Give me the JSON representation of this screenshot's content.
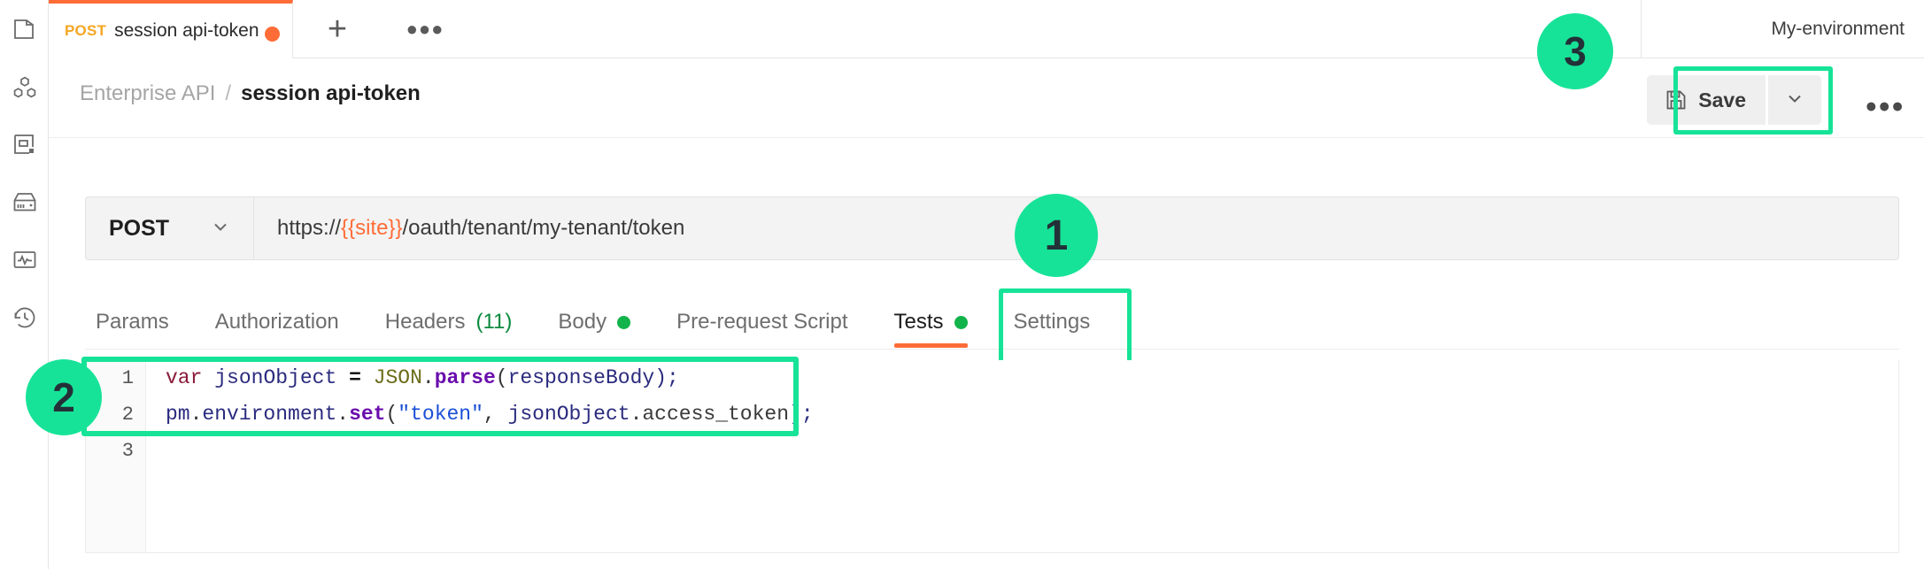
{
  "colors": {
    "accent_orange": "#ff6c37",
    "highlight_green": "#17e398",
    "status_dot_green": "#12b34a",
    "count_green": "#0a8a3e",
    "method_amber": "#f5a623"
  },
  "sidebar": {
    "items": [
      {
        "name": "collections-icon",
        "label": "Collections"
      },
      {
        "name": "apis-icon",
        "label": "APIs"
      },
      {
        "name": "environments-icon",
        "label": "Environments"
      },
      {
        "name": "mock-servers-icon",
        "label": "Mock Servers"
      },
      {
        "name": "monitors-icon",
        "label": "Monitors"
      },
      {
        "name": "history-icon",
        "label": "History"
      }
    ]
  },
  "tabstrip": {
    "request_tab": {
      "method": "POST",
      "title": "session api-token",
      "unsaved_indicator": "●"
    },
    "new_tab_label": "+",
    "tab_options_label": "●●●",
    "environment_selector": "My-environment"
  },
  "breadcrumb": {
    "parent": "Enterprise API",
    "separator": "/",
    "leaf": "session api-token"
  },
  "toolbar": {
    "save_label": "Save",
    "save_caret_icon": "chevron-down-icon",
    "more_label": "●●●"
  },
  "request": {
    "method": "POST",
    "method_caret_icon": "chevron-down-icon",
    "url_prefix": "https://",
    "url_variable": "{{site}}",
    "url_suffix": "/oauth/tenant/my-tenant/token",
    "url_full": "https://{{site}}/oauth/tenant/my-tenant/token"
  },
  "section_tabs": [
    {
      "label": "Params",
      "count": "",
      "dot": false,
      "active": false
    },
    {
      "label": "Authorization",
      "count": "",
      "dot": false,
      "active": false
    },
    {
      "label": "Headers",
      "count": "(11)",
      "dot": false,
      "active": false
    },
    {
      "label": "Body",
      "count": "",
      "dot": true,
      "active": false
    },
    {
      "label": "Pre-request Script",
      "count": "",
      "dot": false,
      "active": false
    },
    {
      "label": "Tests",
      "count": "",
      "dot": true,
      "active": true
    },
    {
      "label": "Settings",
      "count": "",
      "dot": false,
      "active": false
    }
  ],
  "editor": {
    "line_numbers": [
      "1",
      "2",
      "3"
    ],
    "lines": [
      {
        "number": "1",
        "text": "var jsonObject = JSON.parse(responseBody);",
        "tokens": [
          {
            "t": "var",
            "c": "k-var"
          },
          {
            "t": " ",
            "c": "k-punc"
          },
          {
            "t": "jsonObject",
            "c": "k-ident"
          },
          {
            "t": " ",
            "c": "k-punc"
          },
          {
            "t": "=",
            "c": "k-op"
          },
          {
            "t": " ",
            "c": "k-punc"
          },
          {
            "t": "JSON",
            "c": "k-obj"
          },
          {
            "t": ".",
            "c": "k-punc"
          },
          {
            "t": "parse",
            "c": "k-fn"
          },
          {
            "t": "(",
            "c": "k-punc"
          },
          {
            "t": "responseBody",
            "c": "k-ident"
          },
          {
            "t": ");",
            "c": "k-ident"
          }
        ]
      },
      {
        "number": "2",
        "text": "pm.environment.set(\"token\", jsonObject.access_token);",
        "tokens": [
          {
            "t": "pm",
            "c": "k-ident"
          },
          {
            "t": ".",
            "c": "k-punc"
          },
          {
            "t": "environment",
            "c": "k-ident"
          },
          {
            "t": ".",
            "c": "k-punc"
          },
          {
            "t": "set",
            "c": "k-fn"
          },
          {
            "t": "(",
            "c": "k-punc"
          },
          {
            "t": "\"token\"",
            "c": "k-str"
          },
          {
            "t": ", ",
            "c": "k-punc"
          },
          {
            "t": "jsonObject",
            "c": "k-ident"
          },
          {
            "t": ".",
            "c": "k-punc"
          },
          {
            "t": "access_token",
            "c": "k-prop"
          },
          {
            "t": ");",
            "c": "k-ident"
          }
        ]
      },
      {
        "number": "3",
        "text": "",
        "tokens": []
      }
    ]
  },
  "annotations": {
    "badge_1": "1",
    "badge_2": "2",
    "badge_3": "3"
  }
}
